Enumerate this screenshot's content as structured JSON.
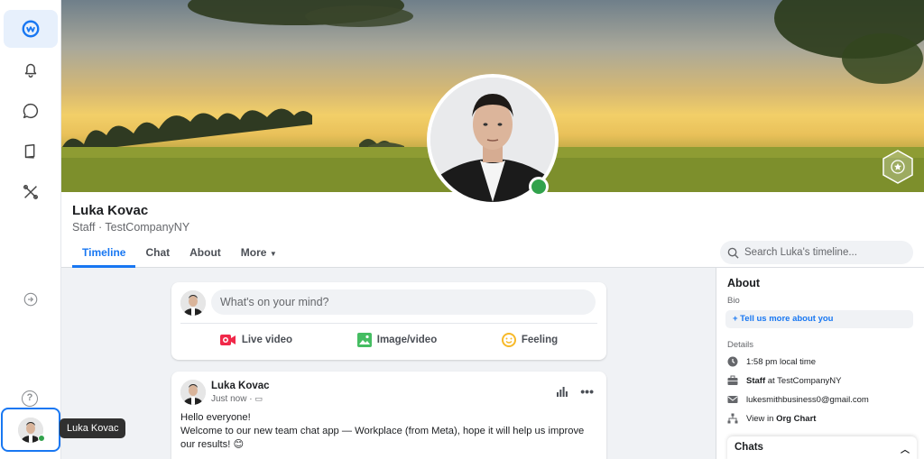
{
  "rail": {
    "items": [
      {
        "name": "workplace-logo",
        "active": true
      },
      {
        "name": "notifications"
      },
      {
        "name": "chat"
      },
      {
        "name": "knowledge-library"
      },
      {
        "name": "tools"
      }
    ],
    "tooltip": "Luka Kovac"
  },
  "profile": {
    "name": "Luka Kovac",
    "subtitle": "Staff · TestCompanyNY",
    "tabs": [
      "Timeline",
      "Chat",
      "About",
      "More"
    ],
    "search_placeholder": "Search Luka's timeline..."
  },
  "composer": {
    "placeholder": "What's on your mind?",
    "actions": [
      "Live video",
      "Image/video",
      "Feeling"
    ]
  },
  "post": {
    "author": "Luka Kovac",
    "time": "Just now · ",
    "line1": "Hello everyone!",
    "line2": "Welcome to our new team chat app — Workplace (from Meta), hope it will help us improve our results! 😊"
  },
  "about": {
    "title": "About",
    "bio_label": "Bio",
    "bio_button": "+  Tell us more about you",
    "details_label": "Details",
    "local_time": "1:58 pm local time",
    "role": "Staff",
    "role_suffix": " at TestCompanyNY",
    "email": "lukesmithbusiness0@gmail.com",
    "org_prefix": "View in ",
    "org_link": "Org Chart"
  },
  "chats": {
    "label": "Chats"
  },
  "colors": {
    "accent": "#1877f2",
    "online": "#31a24c"
  }
}
